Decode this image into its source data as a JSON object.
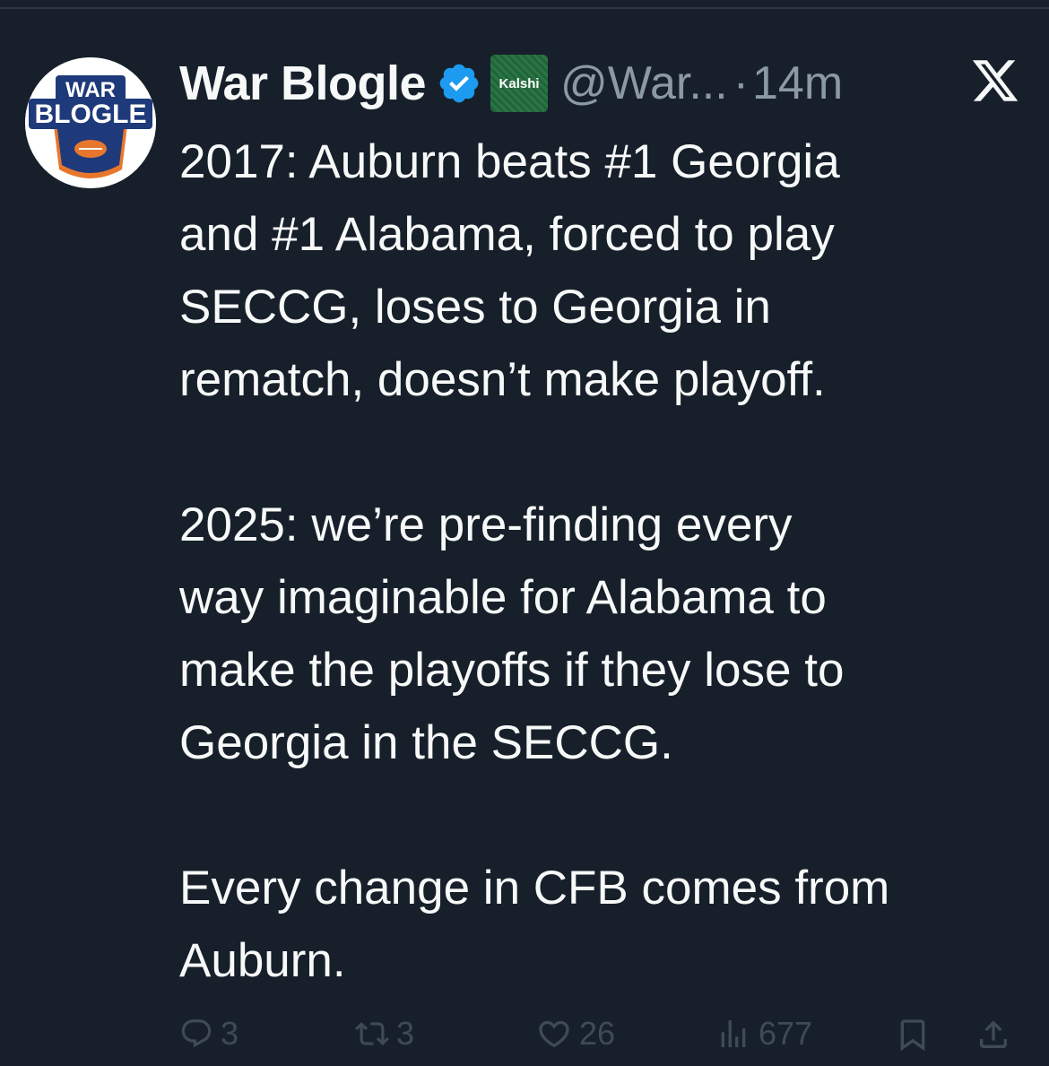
{
  "post": {
    "author": {
      "display_name": "War Blogle",
      "handle": "@War...",
      "separator": "·",
      "time": "14m",
      "avatar_text_top": "WAR",
      "avatar_text_main": "BLOGLE",
      "verified_icon": "verified-badge-icon",
      "affiliate_badge": "Kalshi"
    },
    "text": "2017: Auburn beats #1 Georgia\nand #1 Alabama, forced to play\nSECCG, loses to Georgia in\nrematch, doesn’t make playoff.\n\n2025: we’re pre-finding every\nway imaginable for Alabama to\nmake the playoffs if they lose to\nGeorgia in the SECCG.\n\nEvery change in CFB comes from\nAuburn.",
    "actions": {
      "replies": "3",
      "reposts": "3",
      "likes": "26",
      "views": "677"
    }
  },
  "colors": {
    "background": "#17202a",
    "text": "#f7f9f9",
    "secondary": "#8b98a5",
    "verified": "#1d9bf0",
    "action_icons": "#3e4a55"
  }
}
